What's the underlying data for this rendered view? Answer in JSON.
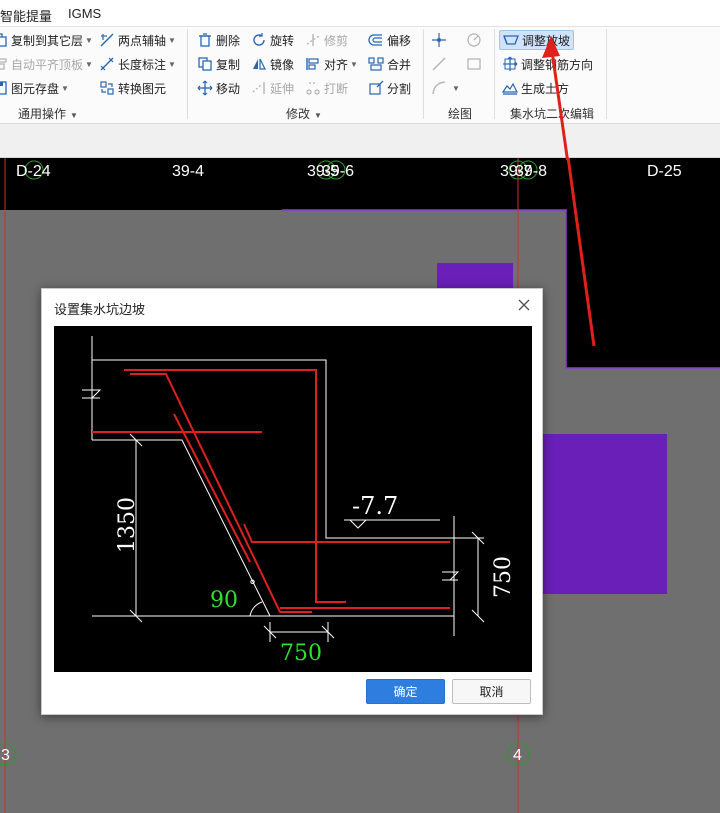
{
  "menubar": {
    "items": [
      "智能提量",
      "IGMS"
    ]
  },
  "ribbon": {
    "general": {
      "copy_to_layer": "复制到其它层",
      "auto_align_top": "自动平齐顶板",
      "save_element": "图元存盘",
      "two_point_axis": "两点辅轴",
      "length_label": "长度标注",
      "convert_element": "转换图元",
      "group_label": "通用操作"
    },
    "modify": {
      "delete": "删除",
      "copy": "复制",
      "move": "移动",
      "rotate": "旋转",
      "mirror": "镜像",
      "extend": "延伸",
      "trim": "修剪",
      "align": "对齐",
      "break": "打断",
      "offset": "偏移",
      "merge": "合并",
      "split": "分割",
      "group_label": "修改"
    },
    "draw": {
      "group_label": "绘图"
    },
    "sump": {
      "adjust_slope": "调整放坡",
      "adjust_rebar_dir": "调整钢筋方向",
      "generate_earthwork": "生成土方",
      "group_label": "集水坑二次编辑"
    }
  },
  "canvas": {
    "axis_labels": [
      "D-24",
      "39-4",
      "39-5",
      "39-6",
      "39-7",
      "39-8",
      "D-25"
    ],
    "bottom_axes": [
      "3",
      "4"
    ],
    "colors": {
      "background": "#6f6f6f",
      "element": "#6a1fb8",
      "axis": "#c83030",
      "circle": "#2d9a2d"
    }
  },
  "dialog": {
    "title": "设置集水坑边坡",
    "preview": {
      "elevation": "-7.7",
      "height_left": "1350",
      "height_right": "750",
      "angle": "90",
      "angle_unit": "°",
      "width_bottom": "750"
    },
    "ok_label": "确定",
    "cancel_label": "取消"
  }
}
